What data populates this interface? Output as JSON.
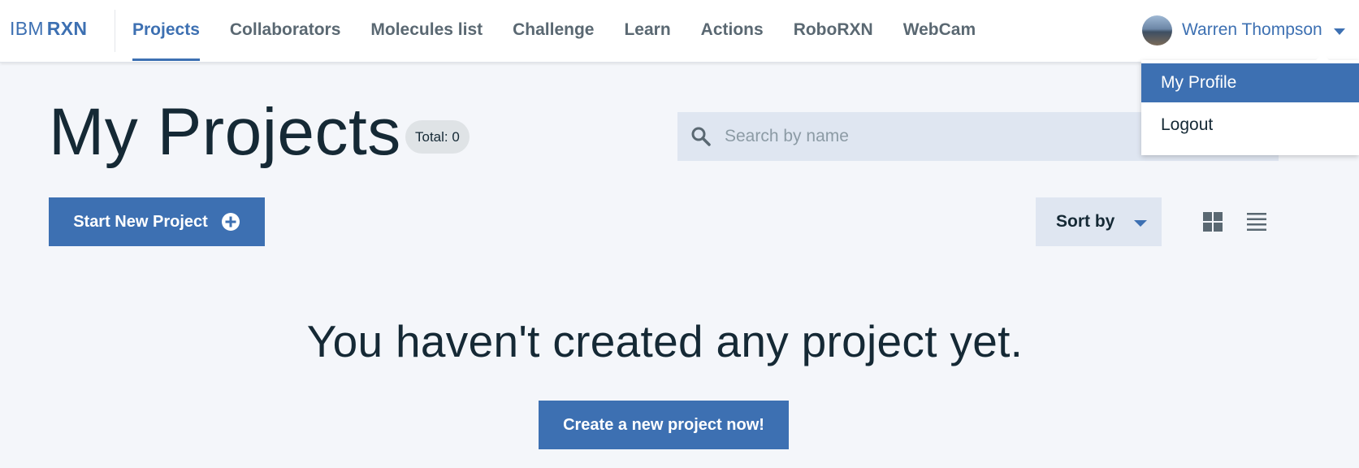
{
  "header": {
    "brand_prefix": "IBM",
    "brand_name": "RXN",
    "nav": [
      {
        "label": "Projects",
        "active": true
      },
      {
        "label": "Collaborators"
      },
      {
        "label": "Molecules list"
      },
      {
        "label": "Challenge"
      },
      {
        "label": "Learn"
      },
      {
        "label": "Actions"
      },
      {
        "label": "RoboRXN"
      },
      {
        "label": "WebCam"
      }
    ],
    "user": {
      "name": "Warren Thompson"
    }
  },
  "user_menu": {
    "items": [
      {
        "label": "My Profile",
        "selected": true
      },
      {
        "label": "Logout"
      }
    ]
  },
  "main": {
    "title": "My Projects",
    "total_label": "Total: 0",
    "search": {
      "placeholder": "Search by name",
      "value": ""
    },
    "start_button": "Start New Project",
    "sort_label": "Sort by",
    "empty_message": "You haven't created any project yet.",
    "create_button": "Create a new project now!"
  },
  "icons": {
    "search": "search-icon",
    "plus": "plus-circle-icon",
    "grid": "grid-view-icon",
    "list": "list-view-icon",
    "caret": "chevron-down-icon"
  },
  "colors": {
    "accent": "#3d70b2",
    "background": "#f4f6fa",
    "field": "#dfe6f1",
    "text": "#152935",
    "nav_text": "#5a6872"
  }
}
